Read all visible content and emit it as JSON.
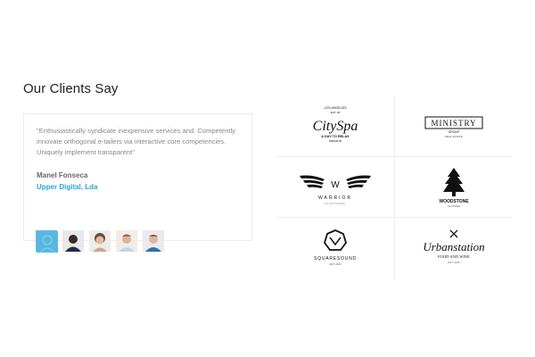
{
  "section": {
    "title": "Our Clients Say"
  },
  "testimonial": {
    "quote": "\"Enthusiastically syndicate inexpensive services and. Competently innovate orthogonal e-tailers via interactive core competencies. Uniquely implement transparent\"",
    "author_name": "Manel Fonseca",
    "author_company": "Upper Digital, Lda"
  },
  "avatars": [
    {
      "name": "avatar-1",
      "active": true,
      "color": "#58b7e0"
    },
    {
      "name": "avatar-2",
      "active": false,
      "color": "#3b2a22"
    },
    {
      "name": "avatar-3",
      "active": false,
      "color": "#c9a98c"
    },
    {
      "name": "avatar-4",
      "active": false,
      "color": "#d9b39a"
    },
    {
      "name": "avatar-5",
      "active": false,
      "color": "#b79a83"
    }
  ],
  "client_logos": {
    "cityspa": {
      "top": "LOS ANGELES",
      "est": "EST. 06",
      "name": "CitySpa",
      "tagline": "A DAY TO RELAX",
      "sub": "PREMIUM"
    },
    "ministry": {
      "name": "MINISTRY",
      "group": "GROUP",
      "sub": "REAL ESTATE"
    },
    "warrior": {
      "mark": "W",
      "name": "WARRIOR",
      "sub": "CLOTHING"
    },
    "woodstone": {
      "name": "WOODSTONE",
      "sub": "CLOTHING"
    },
    "squaresound": {
      "name": "SQUARESOUND",
      "sub": "EST. 2000"
    },
    "urbanstation": {
      "name": "Urbanstation",
      "tagline": "FOOD AND WINE",
      "sub": "EST. 2015"
    }
  },
  "colors": {
    "accent": "#2ba6d4",
    "divider": "#eeeeee",
    "text_muted": "#888888"
  }
}
